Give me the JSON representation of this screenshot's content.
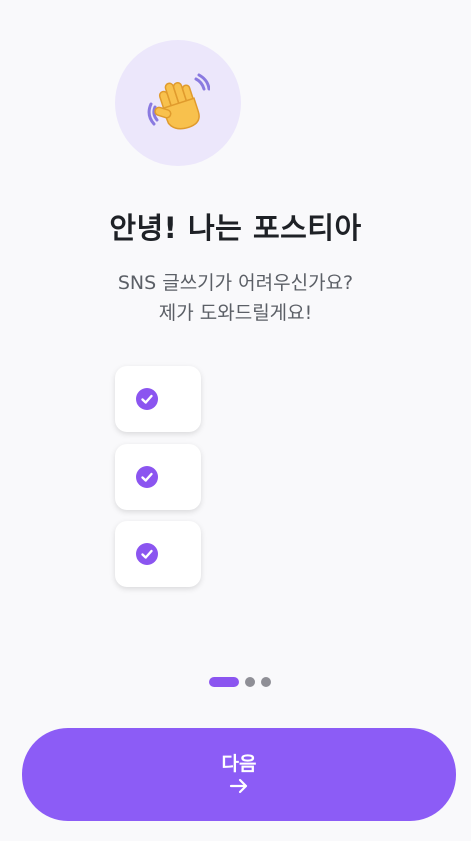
{
  "hero": {
    "icon": "waving-hand-icon",
    "circle_color": "#ece7fb"
  },
  "title": "안녕! 나는 포스티아",
  "subtitle": {
    "line1": "SNS 글쓰기가 어려우신가요?",
    "line2": "제가 도와드릴게요!"
  },
  "checklist": {
    "items": [
      {
        "icon": "check-circle-icon",
        "checked": true
      },
      {
        "icon": "check-circle-icon",
        "checked": true
      },
      {
        "icon": "check-circle-icon",
        "checked": true
      }
    ]
  },
  "pager": {
    "total_pages": 3,
    "current_page": 1
  },
  "next_button": {
    "label": "다음",
    "icon": "arrow-right-icon"
  },
  "colors": {
    "accent": "#8c5cf6",
    "background": "#f9f9fb",
    "title": "#1e2126",
    "subtitle": "#5b5f66",
    "inactive_dot": "#8f8f96"
  }
}
